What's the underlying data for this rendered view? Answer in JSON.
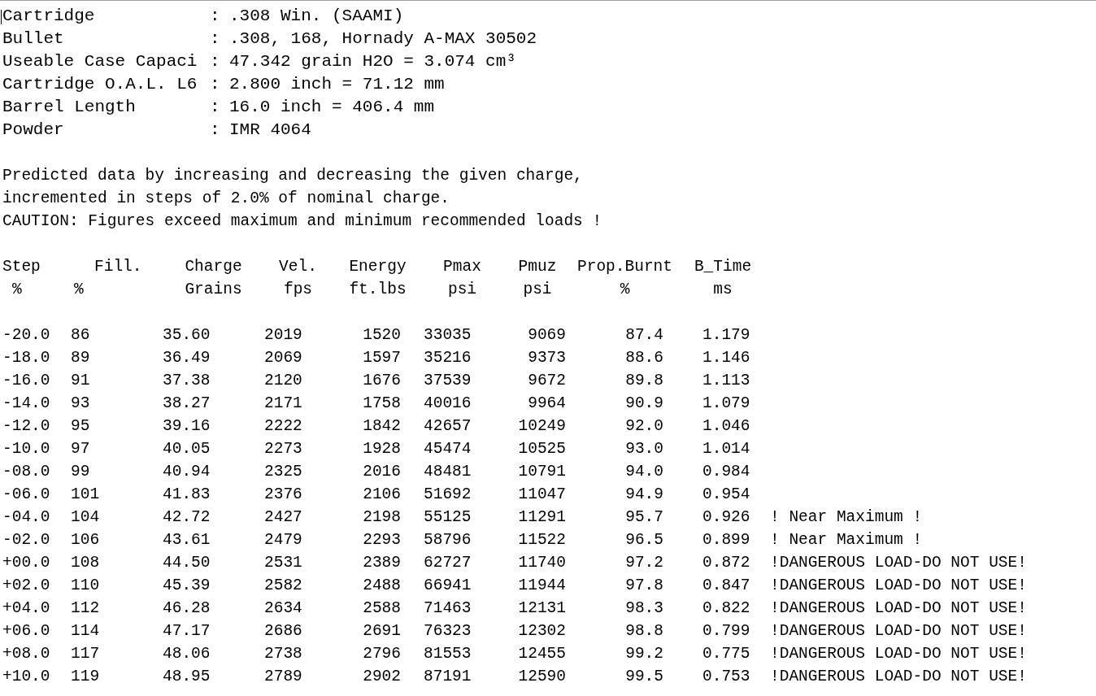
{
  "field_separator": ":",
  "header_fields": [
    {
      "label": "Cartridge",
      "value": ".308 Win. (SAAMI)"
    },
    {
      "label": "Bullet",
      "value": ".308, 168, Hornady A-MAX 30502"
    },
    {
      "label": "Useable Case Capaci",
      "value": "47.342 grain H2O = 3.074 cm³"
    },
    {
      "label": "Cartridge O.A.L. L6",
      "value": "2.800 inch = 71.12 mm"
    },
    {
      "label": "Barrel Length",
      "value": "16.0 inch = 406.4 mm"
    },
    {
      "label": "Powder",
      "value": "IMR 4064"
    }
  ],
  "notes": [
    "Predicted data by increasing and decreasing the given charge,",
    "incremented in steps of 2.0% of nominal charge.",
    "CAUTION: Figures exceed maximum and minimum recommended loads !"
  ],
  "table": {
    "columns": [
      {
        "name": "Step",
        "unit": "%"
      },
      {
        "name": "Fill.",
        "unit": "%"
      },
      {
        "name": "Charge",
        "unit": "Grains"
      },
      {
        "name": "Vel.",
        "unit": "fps"
      },
      {
        "name": "Energy",
        "unit": "ft.lbs"
      },
      {
        "name": "Pmax",
        "unit": "psi"
      },
      {
        "name": "Pmuz",
        "unit": "psi"
      },
      {
        "name": "Prop.Burnt",
        "unit": "%"
      },
      {
        "name": "B_Time",
        "unit": "ms"
      }
    ],
    "rows": [
      {
        "values": [
          "-20.0",
          "86",
          "35.60",
          "2019",
          "1520",
          "33035",
          "9069",
          "87.4",
          "1.179"
        ]
      },
      {
        "values": [
          "-18.0",
          "89",
          "36.49",
          "2069",
          "1597",
          "35216",
          "9373",
          "88.6",
          "1.146"
        ]
      },
      {
        "values": [
          "-16.0",
          "91",
          "37.38",
          "2120",
          "1676",
          "37539",
          "9672",
          "89.8",
          "1.113"
        ]
      },
      {
        "values": [
          "-14.0",
          "93",
          "38.27",
          "2171",
          "1758",
          "40016",
          "9964",
          "90.9",
          "1.079"
        ]
      },
      {
        "values": [
          "-12.0",
          "95",
          "39.16",
          "2222",
          "1842",
          "42657",
          "10249",
          "92.0",
          "1.046"
        ]
      },
      {
        "values": [
          "-10.0",
          "97",
          "40.05",
          "2273",
          "1928",
          "45474",
          "10525",
          "93.0",
          "1.014"
        ]
      },
      {
        "values": [
          "-08.0",
          "99",
          "40.94",
          "2325",
          "2016",
          "48481",
          "10791",
          "94.0",
          "0.984"
        ]
      },
      {
        "values": [
          "-06.0",
          "101",
          "41.83",
          "2376",
          "2106",
          "51692",
          "11047",
          "94.9",
          "0.954"
        ]
      },
      {
        "values": [
          "-04.0",
          "104",
          "42.72",
          "2427",
          "2198",
          "55125",
          "11291",
          "95.7",
          "0.926"
        ],
        "warning": "! Near Maximum !"
      },
      {
        "values": [
          "-02.0",
          "106",
          "43.61",
          "2479",
          "2293",
          "58796",
          "11522",
          "96.5",
          "0.899"
        ],
        "warning": "! Near Maximum !"
      },
      {
        "values": [
          "+00.0",
          "108",
          "44.50",
          "2531",
          "2389",
          "62727",
          "11740",
          "97.2",
          "0.872"
        ],
        "warning": "!DANGEROUS LOAD-DO NOT USE!"
      },
      {
        "values": [
          "+02.0",
          "110",
          "45.39",
          "2582",
          "2488",
          "66941",
          "11944",
          "97.8",
          "0.847"
        ],
        "warning": "!DANGEROUS LOAD-DO NOT USE!"
      },
      {
        "values": [
          "+04.0",
          "112",
          "46.28",
          "2634",
          "2588",
          "71463",
          "12131",
          "98.3",
          "0.822"
        ],
        "warning": "!DANGEROUS LOAD-DO NOT USE!"
      },
      {
        "values": [
          "+06.0",
          "114",
          "47.17",
          "2686",
          "2691",
          "76323",
          "12302",
          "98.8",
          "0.799"
        ],
        "warning": "!DANGEROUS LOAD-DO NOT USE!"
      },
      {
        "values": [
          "+08.0",
          "117",
          "48.06",
          "2738",
          "2796",
          "81553",
          "12455",
          "99.2",
          "0.775"
        ],
        "warning": "!DANGEROUS LOAD-DO NOT USE!"
      },
      {
        "values": [
          "+10.0",
          "119",
          "48.95",
          "2789",
          "2902",
          "87191",
          "12590",
          "99.5",
          "0.753"
        ],
        "warning": "!DANGEROUS LOAD-DO NOT USE!"
      }
    ]
  }
}
